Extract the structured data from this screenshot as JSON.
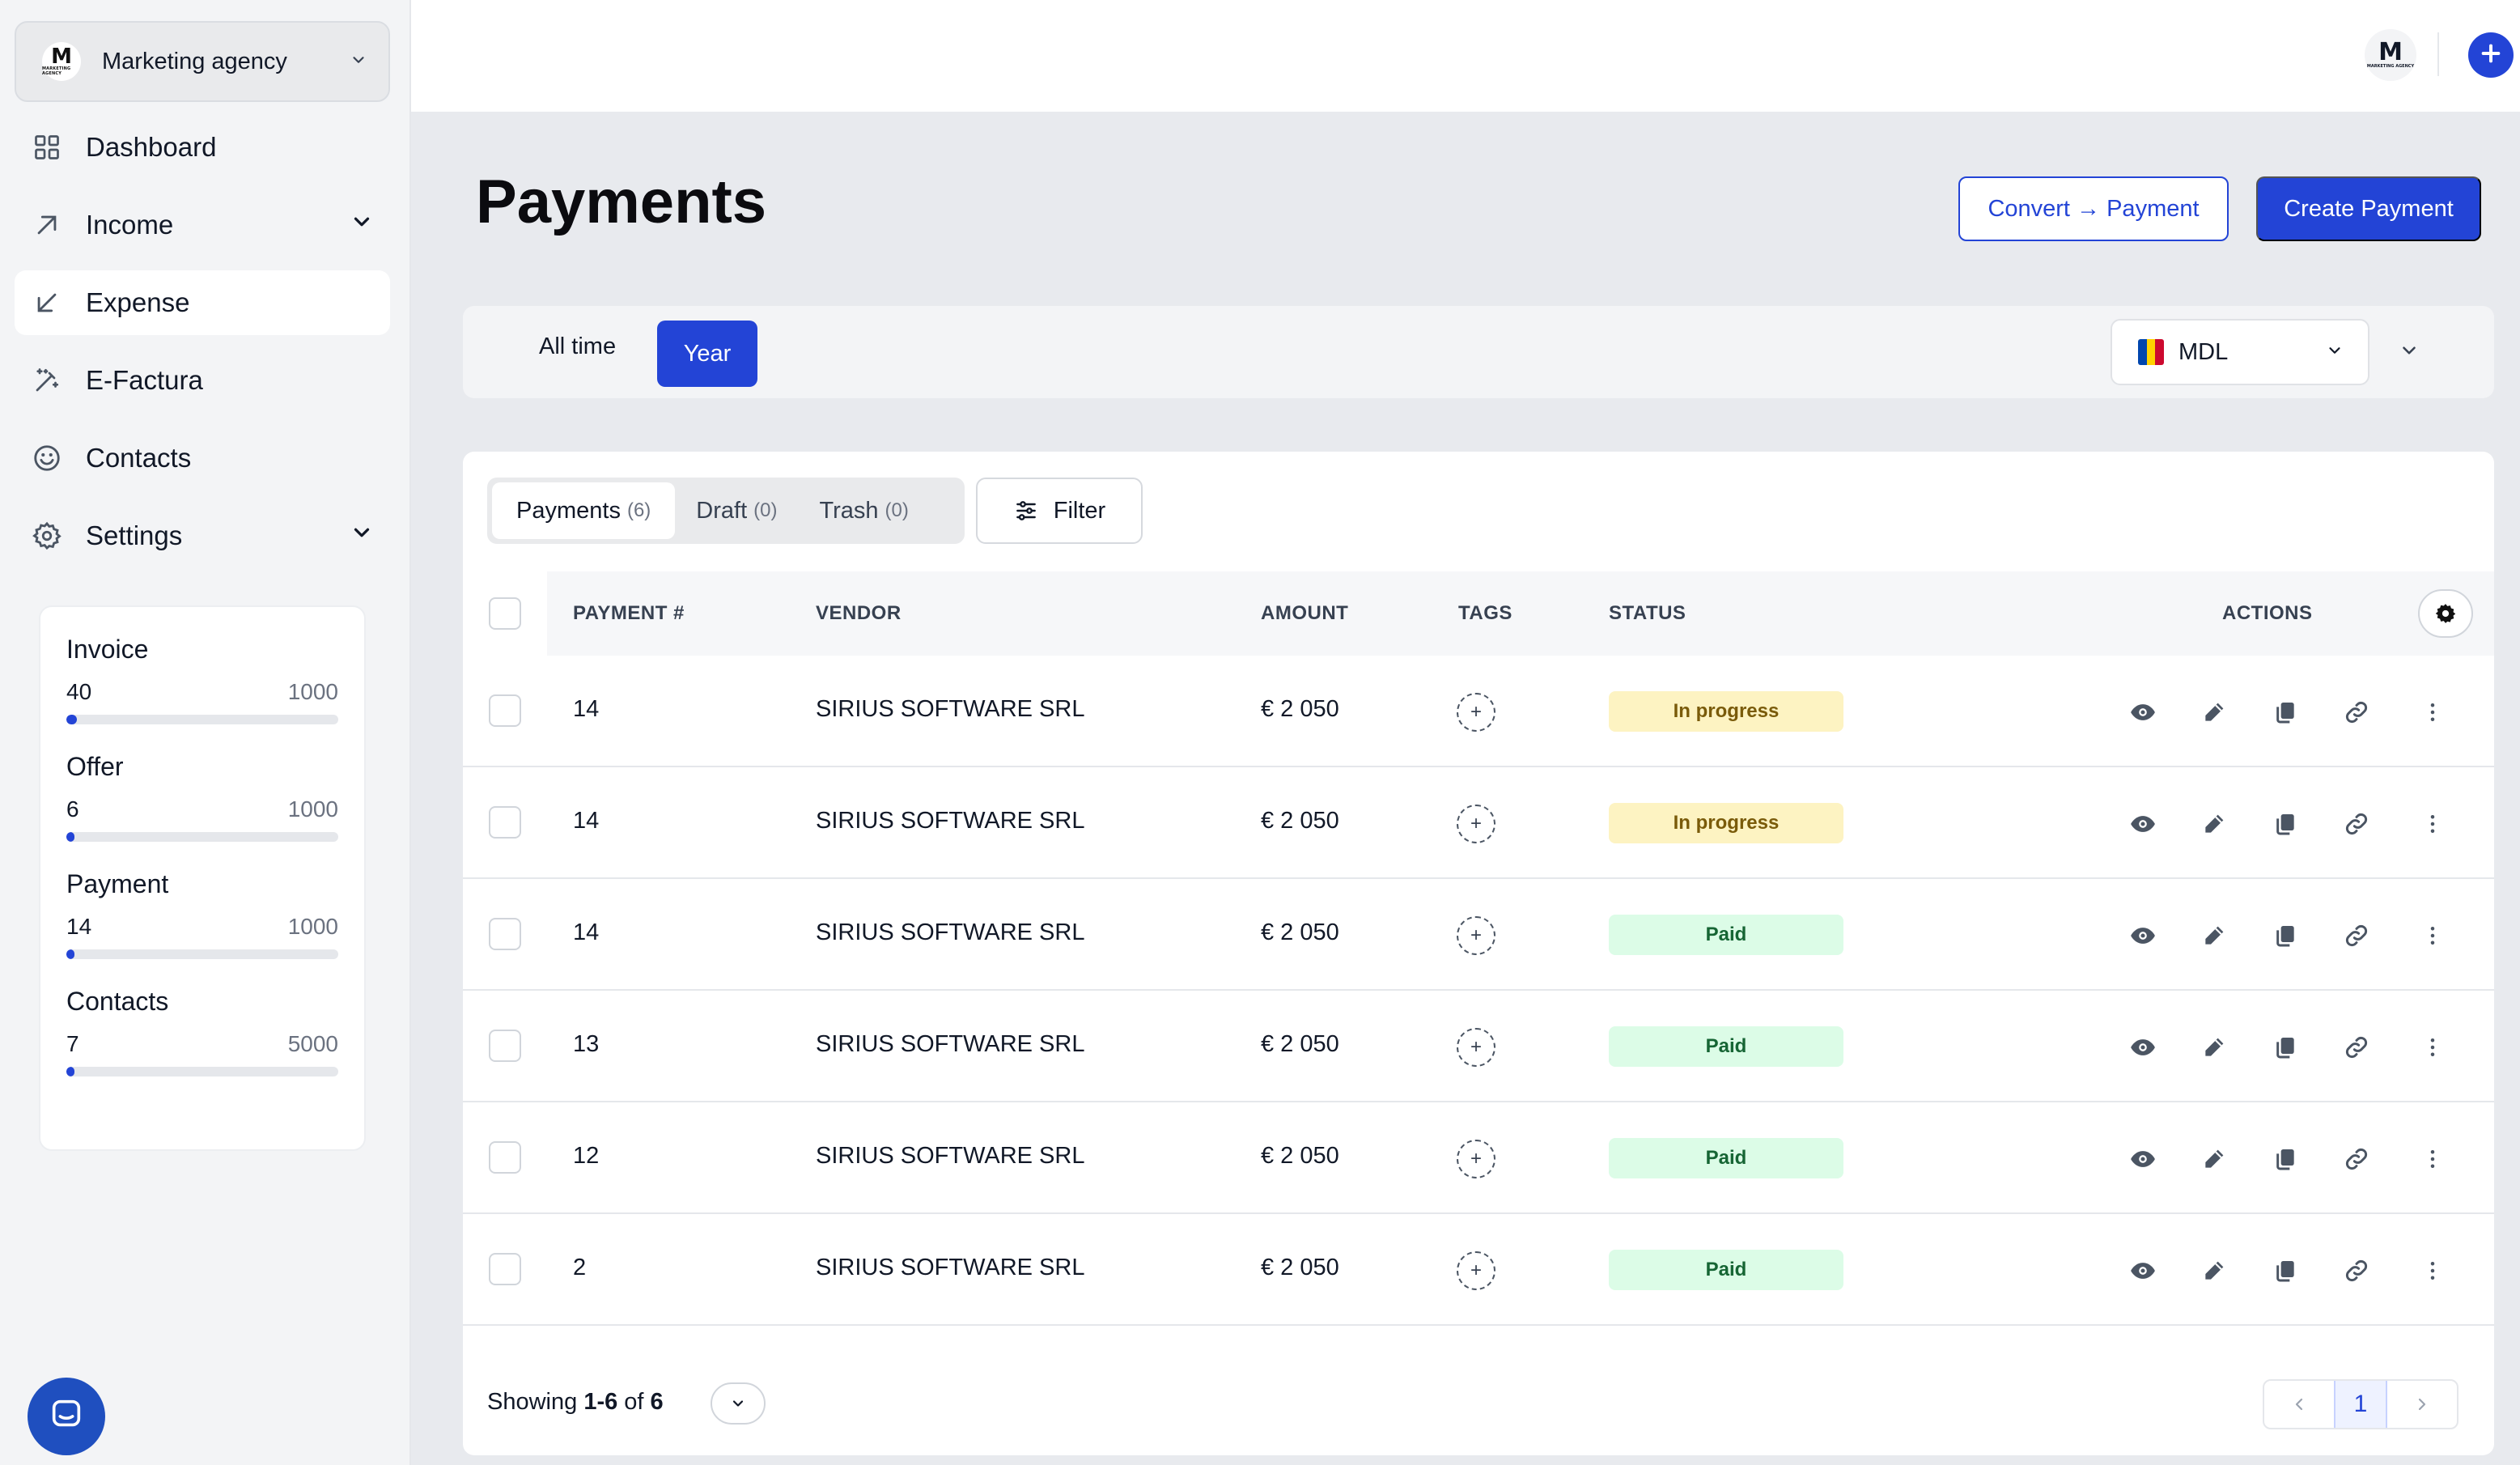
{
  "org": {
    "name": "Marketing agency",
    "logo_letter": "M",
    "logo_subtext": "MARKETING AGENCY"
  },
  "nav": [
    {
      "label": "Dashboard",
      "icon": "grid-icon"
    },
    {
      "label": "Income",
      "icon": "arrow-up-right-icon",
      "expandable": true
    },
    {
      "label": "Expense",
      "icon": "arrow-down-left-icon",
      "active": true
    },
    {
      "label": "E-Factura",
      "icon": "magic-wand-icon"
    },
    {
      "label": "Contacts",
      "icon": "smiley-icon"
    },
    {
      "label": "Settings",
      "icon": "gear-icon",
      "expandable": true
    }
  ],
  "usage": [
    {
      "title": "Invoice",
      "current": "40",
      "max": "1000",
      "fraction": 0.04
    },
    {
      "title": "Offer",
      "current": "6",
      "max": "1000",
      "fraction": 0.006
    },
    {
      "title": "Payment",
      "current": "14",
      "max": "1000",
      "fraction": 0.014
    },
    {
      "title": "Contacts",
      "current": "7",
      "max": "5000",
      "fraction": 0.0014
    }
  ],
  "topbar": {
    "avatar_letter": "M",
    "avatar_subtext": "MARKETING AGENCY"
  },
  "page": {
    "title": "Payments",
    "convert_label": "Convert → Payment",
    "create_label": "Create Payment"
  },
  "period": {
    "all_time": "All time",
    "year": "Year",
    "currency": "MDL"
  },
  "tabs": [
    {
      "label": "Payments",
      "count": "(6)",
      "active": true
    },
    {
      "label": "Draft",
      "count": "(0)"
    },
    {
      "label": "Trash",
      "count": "(0)"
    }
  ],
  "filter_label": "Filter",
  "columns": {
    "payment": "PAYMENT #",
    "vendor": "VENDOR",
    "amount": "AMOUNT",
    "tags": "TAGS",
    "status": "STATUS",
    "actions": "ACTIONS"
  },
  "rows": [
    {
      "number": "14",
      "vendor": "SIRIUS SOFTWARE SRL",
      "amount": "€ 2 050",
      "status": "In progress",
      "status_kind": "progress"
    },
    {
      "number": "14",
      "vendor": "SIRIUS SOFTWARE SRL",
      "amount": "€ 2 050",
      "status": "In progress",
      "status_kind": "progress"
    },
    {
      "number": "14",
      "vendor": "SIRIUS SOFTWARE SRL",
      "amount": "€ 2 050",
      "status": "Paid",
      "status_kind": "paid"
    },
    {
      "number": "13",
      "vendor": "SIRIUS SOFTWARE SRL",
      "amount": "€ 2 050",
      "status": "Paid",
      "status_kind": "paid"
    },
    {
      "number": "12",
      "vendor": "SIRIUS SOFTWARE SRL",
      "amount": "€ 2 050",
      "status": "Paid",
      "status_kind": "paid"
    },
    {
      "number": "2",
      "vendor": "SIRIUS SOFTWARE SRL",
      "amount": "€ 2 050",
      "status": "Paid",
      "status_kind": "paid"
    }
  ],
  "footer": {
    "showing_prefix": "Showing",
    "range": "1-6",
    "of": "of",
    "total": "6",
    "current_page": "1"
  },
  "colors": {
    "accent": "#2344d6",
    "progress_bg": "#fdf3c2",
    "paid_bg": "#dcfce7"
  }
}
